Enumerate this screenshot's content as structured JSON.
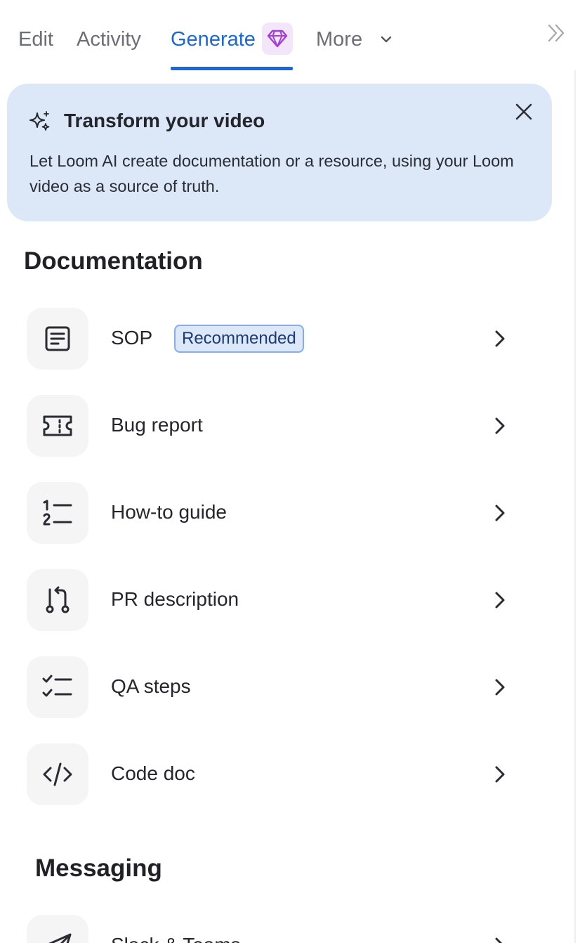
{
  "tabs": {
    "edit": "Edit",
    "activity": "Activity",
    "generate": "Generate",
    "more": "More"
  },
  "banner": {
    "title": "Transform your video",
    "text": "Let Loom AI create documentation or a resource, using your Loom video as a source of truth."
  },
  "sections": {
    "documentation": "Documentation",
    "messaging": "Messaging"
  },
  "documentation_items": [
    {
      "label": "SOP",
      "badge": "Recommended",
      "icon": "document-icon"
    },
    {
      "label": "Bug report",
      "icon": "ticket-icon"
    },
    {
      "label": "How-to guide",
      "icon": "numbered-list-icon"
    },
    {
      "label": "PR description",
      "icon": "pull-request-icon"
    },
    {
      "label": "QA steps",
      "icon": "checklist-icon"
    },
    {
      "label": "Code doc",
      "icon": "code-icon"
    }
  ],
  "messaging_items": [
    {
      "label": "Slack & Teams",
      "icon": "send-icon"
    }
  ],
  "colors": {
    "accent": "#1868db",
    "banner_bg": "#dce8f8",
    "gem_bg": "#f3e6fb",
    "gem": "#a33fd6"
  }
}
